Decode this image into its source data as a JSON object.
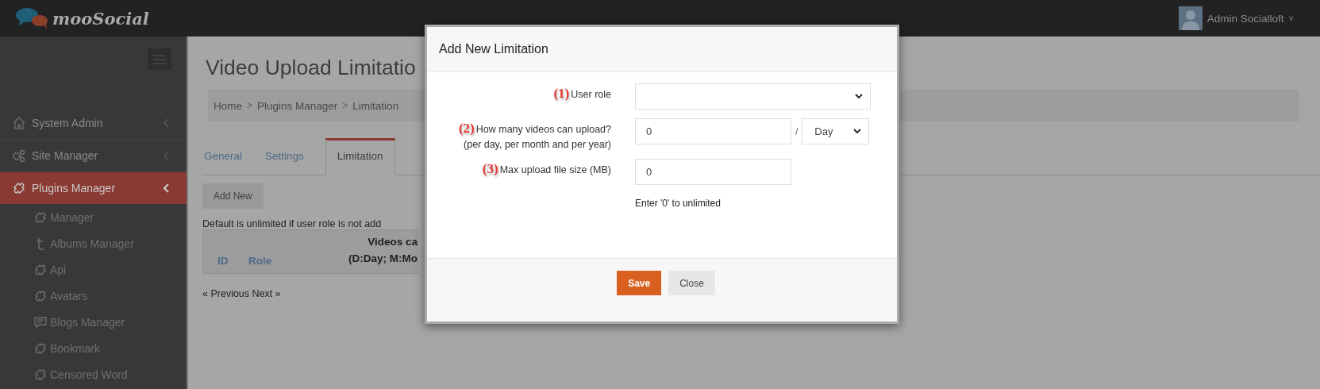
{
  "header": {
    "logo_text": "mooSocial",
    "user_name": "Admin Socialloft",
    "user_caret": "˅"
  },
  "sidebar": {
    "items": [
      {
        "label": "System Admin",
        "selected": false
      },
      {
        "label": "Site Manager",
        "selected": false
      },
      {
        "label": "Plugins Manager",
        "selected": true,
        "children": [
          {
            "label": "Manager"
          },
          {
            "label": "Albums Manager"
          },
          {
            "label": "Api"
          },
          {
            "label": "Avatars"
          },
          {
            "label": "Blogs Manager"
          },
          {
            "label": "Bookmark"
          },
          {
            "label": "Censored Word"
          }
        ]
      }
    ]
  },
  "page": {
    "title": "Video Upload Limitatio",
    "breadcrumb": [
      {
        "label": "Home",
        "kind": "link"
      },
      {
        "label": ">",
        "kind": "sep"
      },
      {
        "label": "Plugins Manager",
        "kind": "link"
      },
      {
        "label": ">",
        "kind": "sep"
      },
      {
        "label": "Limitation",
        "kind": "link"
      }
    ],
    "tabs": [
      {
        "label": "General",
        "selected": false
      },
      {
        "label": "Settings",
        "selected": false
      },
      {
        "label": "Limitation",
        "selected": true
      }
    ],
    "add_button": "Add New",
    "note": "Default is unlimited if user role is not add",
    "table": {
      "columns": [
        {
          "lines": [
            "ID"
          ]
        },
        {
          "lines": [
            "Role"
          ]
        },
        {
          "lines": [
            "Videos ca",
            "(D:Day; M:Mo"
          ]
        }
      ]
    },
    "pagination": "« Previous Next »"
  },
  "modal": {
    "title": "Add New Limitation",
    "fields": [
      {
        "number": "(1)",
        "label": "User role",
        "kind": "select"
      },
      {
        "number": "(2)",
        "label": "How many videos can upload?",
        "sublabel": "(per day, per month and per year)",
        "kind": "count-period",
        "value": "0",
        "separator": "/",
        "period": "Day"
      },
      {
        "number": "(3)",
        "label": "Max upload file size (MB)",
        "kind": "input",
        "value": "0",
        "hint": "Enter '0' to unlimited"
      }
    ],
    "buttons": [
      {
        "label": "Save",
        "kind": "primary"
      },
      {
        "label": "Close",
        "kind": "default"
      }
    ]
  }
}
